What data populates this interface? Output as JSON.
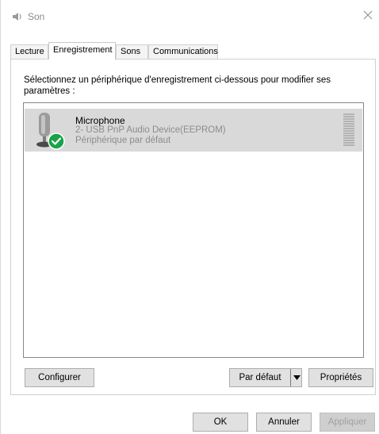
{
  "window": {
    "title": "Son",
    "icon": "speaker-icon",
    "close_icon": "close-icon"
  },
  "tabs": [
    {
      "label": "Lecture",
      "active": false
    },
    {
      "label": "Enregistrement",
      "active": true
    },
    {
      "label": "Sons",
      "active": false
    },
    {
      "label": "Communications",
      "active": false
    }
  ],
  "panel": {
    "instruction_line1": "Sélectionnez un périphérique d'enregistrement ci-dessous pour modifier ses",
    "instruction_line2": "paramètres :"
  },
  "devices": [
    {
      "name": "Microphone",
      "description": "2- USB PnP Audio Device(EEPROM)",
      "status": "Périphérique par défaut",
      "icon": "microphone-icon",
      "status_icon": "checkmark-icon",
      "status_color": "#1aa34a",
      "selected": true
    }
  ],
  "panel_buttons": {
    "configure": "Configurer",
    "set_default": "Par défaut",
    "properties": "Propriétés"
  },
  "dialog_buttons": {
    "ok": "OK",
    "cancel": "Annuler",
    "apply": "Appliquer"
  }
}
